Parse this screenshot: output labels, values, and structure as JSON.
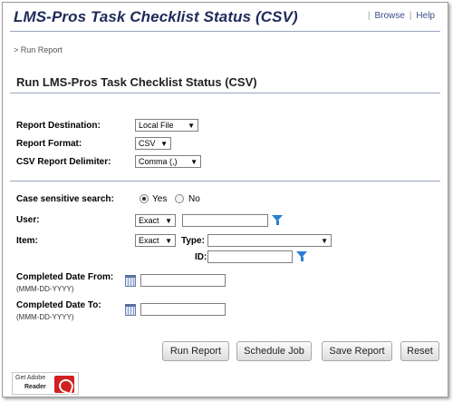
{
  "header": {
    "title": "LMS-Pros Task Checklist Status (CSV)",
    "links": [
      "Browse",
      "Help"
    ]
  },
  "breadcrumb": "> Run Report",
  "section_title": "Run LMS-Pros Task Checklist Status (CSV)",
  "report_settings": {
    "destination_label": "Report Destination:",
    "destination_value": "Local File",
    "format_label": "Report Format:",
    "format_value": "CSV",
    "delimiter_label": "CSV Report Delimiter:",
    "delimiter_value": "Comma (,)"
  },
  "criteria": {
    "case_label": "Case sensitive search:",
    "case_yes": "Yes",
    "case_no": "No",
    "case_selected": "Yes",
    "user_label": "User:",
    "user_match": "Exact",
    "user_value": "",
    "item_label": "Item:",
    "item_match": "Exact",
    "type_label": "Type:",
    "type_value": "",
    "id_label": "ID:",
    "id_value": "",
    "date_from_label": "Completed Date From:",
    "date_from_hint": "(MMM-DD-YYYY)",
    "date_from_value": "",
    "date_to_label": "Completed Date To:",
    "date_to_hint": "(MMM-DD-YYYY)",
    "date_to_value": ""
  },
  "buttons": {
    "run": "Run Report",
    "schedule": "Schedule Job",
    "save": "Save Report",
    "reset": "Reset"
  },
  "footer": {
    "adobe_get": "Get Adobe",
    "adobe_reader": "Reader"
  },
  "icons": {
    "filter": "filter-icon",
    "calendar": "calendar-icon",
    "dropdown": "chevron-down-icon"
  },
  "colors": {
    "title": "#1f2a5a",
    "link": "#3a4f8a",
    "filter": "#2a7fd4",
    "adobe": "#d21f1f"
  }
}
